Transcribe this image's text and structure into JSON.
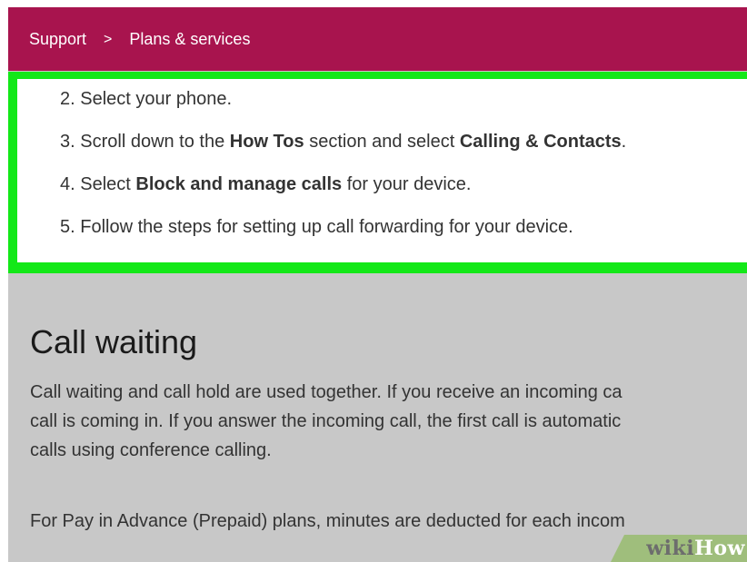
{
  "breadcrumb": {
    "items": [
      "Support",
      "Plans & services"
    ],
    "separator": ">"
  },
  "steps": [
    {
      "number": "2.",
      "parts": [
        {
          "t": "Select your phone.",
          "b": false
        }
      ]
    },
    {
      "number": "3.",
      "parts": [
        {
          "t": "Scroll down to the ",
          "b": false
        },
        {
          "t": "How Tos",
          "b": true
        },
        {
          "t": " section and select ",
          "b": false
        },
        {
          "t": "Calling & Contacts",
          "b": true
        },
        {
          "t": ".",
          "b": false
        }
      ]
    },
    {
      "number": "4.",
      "parts": [
        {
          "t": "Select ",
          "b": false
        },
        {
          "t": "Block and manage calls",
          "b": true
        },
        {
          "t": " for your device.",
          "b": false
        }
      ]
    },
    {
      "number": "5.",
      "parts": [
        {
          "t": "Follow the steps for setting up call forwarding for your device.",
          "b": false
        }
      ]
    }
  ],
  "section": {
    "title": "Call waiting",
    "paragraph1_lines": [
      "Call waiting and call hold are used together. If you receive an incoming ca",
      "call is coming in. If you answer the incoming call, the first call is automatic",
      "calls using conference calling."
    ],
    "paragraph2": "For Pay in Advance (Prepaid) plans, minutes are deducted for each incom"
  },
  "watermark": {
    "wiki": "wiki",
    "how": "How"
  },
  "colors": {
    "header_bg": "#a8144e",
    "highlight_border": "#13e818",
    "page_bg": "#c8c8c8"
  }
}
